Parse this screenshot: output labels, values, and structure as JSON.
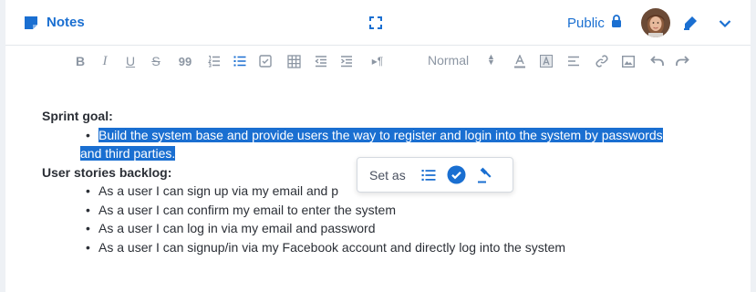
{
  "header": {
    "title": "Notes",
    "visibility": "Public",
    "icons": [
      "notes-icon",
      "expand-icon",
      "lock-icon",
      "avatar",
      "edit-pen-icon",
      "chevron-down-icon"
    ]
  },
  "toolbar": {
    "items": [
      "bold",
      "italic",
      "underline",
      "strikethrough",
      "quote",
      "ordered-list",
      "bullet-list",
      "checklist",
      "table",
      "outdent",
      "indent",
      "paragraph-direction",
      "font-color",
      "highlight",
      "align",
      "link",
      "image",
      "undo",
      "redo"
    ],
    "bold_label": "B",
    "italic_label": "I",
    "underline_label": "U",
    "strike_label": "S",
    "quote_label": "99",
    "paragraph_label": "▸¶",
    "style_select": "Normal"
  },
  "document": {
    "sprint_heading": "Sprint goal:",
    "sprint_goal_line1": "Build the system base and provide users the way to register and login into the system by passwords",
    "sprint_goal_line2": "and third parties.",
    "backlog_heading": "User stories backlog:",
    "backlog_items": [
      "As a user I can sign up via my email and p",
      "As a user I can confirm my email to enter the system",
      "As a user I can log in via my email and password",
      "As a user I can signup/in via my Facebook account and directly log into the system"
    ]
  },
  "popup": {
    "label": "Set as",
    "options": [
      "list-icon",
      "check-circle-icon",
      "gavel-icon"
    ]
  },
  "colors": {
    "accent": "#1a6fd1",
    "selection": "#1a6fd1",
    "toolbar_icon": "#8c96a3",
    "text": "#2b2f36"
  }
}
